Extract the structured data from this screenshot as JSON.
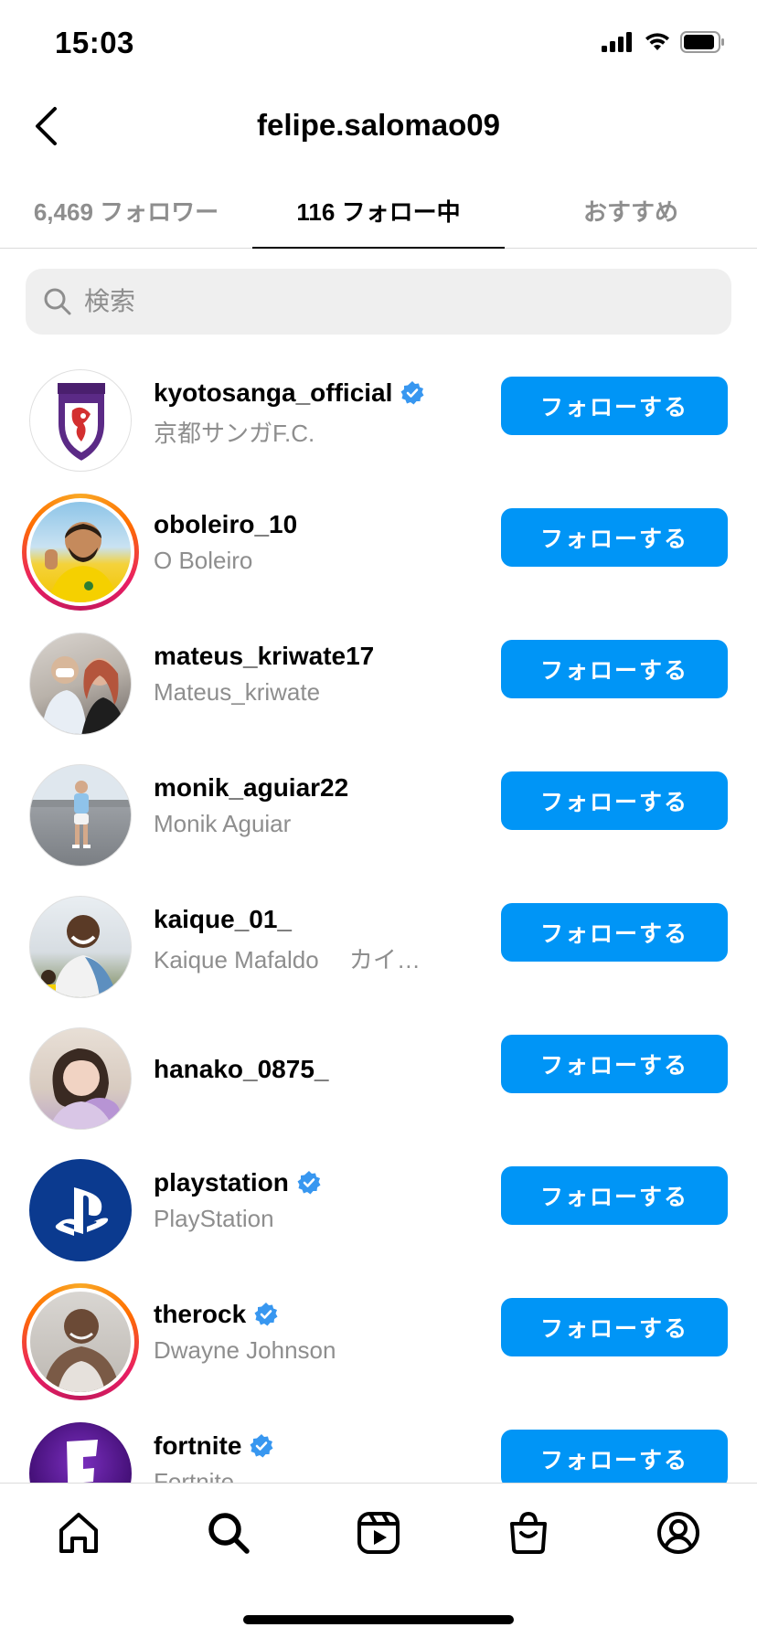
{
  "status_bar": {
    "time": "15:03"
  },
  "header": {
    "title": "felipe.salomao09"
  },
  "tabs": [
    {
      "label": "6,469 フォロワー",
      "active": false
    },
    {
      "label": "116 フォロー中",
      "active": true
    },
    {
      "label": "おすすめ",
      "active": false
    }
  ],
  "search": {
    "placeholder": "検索",
    "value": ""
  },
  "follow_button_label": "フォローする",
  "users": [
    {
      "username": "kyotosanga_official",
      "full_name": "京都サンガF.C.",
      "verified": true,
      "story_ring": false
    },
    {
      "username": "oboleiro_10",
      "full_name": "O Boleiro",
      "verified": false,
      "story_ring": true
    },
    {
      "username": "mateus_kriwate17",
      "full_name": "Mateus_kriwate",
      "verified": false,
      "story_ring": false
    },
    {
      "username": "monik_aguiar22",
      "full_name": "Monik Aguiar",
      "verified": false,
      "story_ring": false
    },
    {
      "username": "kaique_01_",
      "full_name": "Kaique Mafaldo　 カイ…",
      "verified": false,
      "story_ring": false
    },
    {
      "username": "hanako_0875_",
      "full_name": "",
      "verified": false,
      "story_ring": false
    },
    {
      "username": "playstation",
      "full_name": "PlayStation",
      "verified": true,
      "story_ring": false
    },
    {
      "username": "therock",
      "full_name": "Dwayne Johnson",
      "verified": true,
      "story_ring": true
    },
    {
      "username": "fortnite",
      "full_name": "Fortnite",
      "verified": true,
      "story_ring": false
    }
  ],
  "colors": {
    "accent": "#0095f6",
    "verified": "#3897f0",
    "secondary_text": "#8e8e8e"
  }
}
